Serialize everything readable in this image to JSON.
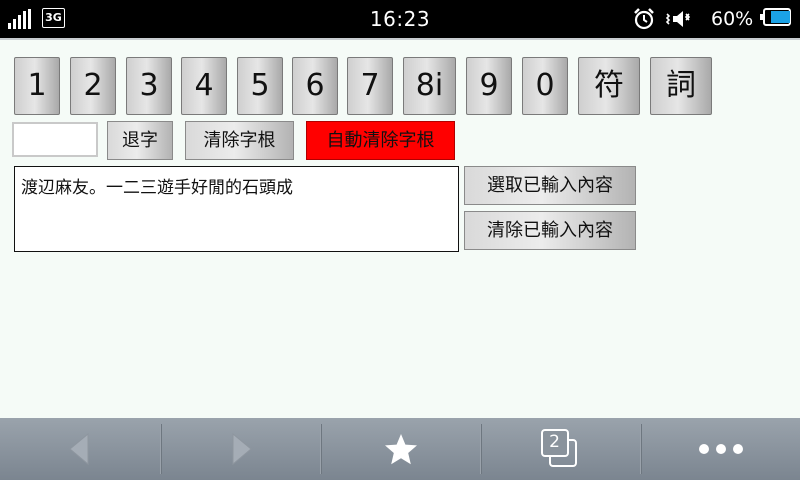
{
  "status_bar": {
    "time": "16:23",
    "network": "3G",
    "battery_percent": "60%",
    "battery_level": 0.6,
    "icons": [
      "signal-icon",
      "network-3g-icon",
      "alarm-icon",
      "speaker-vibrate-icon",
      "battery-icon"
    ]
  },
  "keys": [
    "1",
    "2",
    "3",
    "4",
    "5",
    "6",
    "7",
    "8i",
    "9",
    "0",
    "符",
    "詞"
  ],
  "controls": {
    "radical_input_value": "",
    "backspace_label": "退字",
    "clear_radicals_label": "清除字根",
    "auto_clear_label": "自動清除字根",
    "auto_clear_color": "#ff0000"
  },
  "output": {
    "text": "渡辺麻友。一二三遊手好閒的石頭成",
    "select_label": "選取已輸入內容",
    "clear_label": "清除已輸入內容"
  },
  "toolbar": {
    "tab_count": "2",
    "icons": [
      "back-icon",
      "forward-icon",
      "bookmark-star-icon",
      "tabs-icon",
      "more-icon"
    ]
  }
}
